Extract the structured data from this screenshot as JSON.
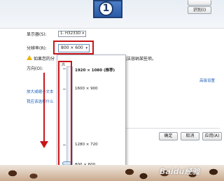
{
  "monitor": {
    "number": "1"
  },
  "buttons": {
    "detect_label": "",
    "identify_label": "识别(I)",
    "ok": "确定",
    "cancel": "取消",
    "apply": "应用(A)"
  },
  "form": {
    "display_label": "显示器(S):",
    "display_value": "1. H3233D",
    "resolution_label": "分辨率(R):",
    "resolution_value": "800 × 600",
    "warning_text": "如果您的分",
    "warning_text_2": "无法容纳某些项。",
    "orientation_label": "方向(O):"
  },
  "links": {
    "advanced": "高级设置",
    "enlarge": "放大或缩小文本",
    "which_settings": "我应该选择什么"
  },
  "resolution_options": [
    "1920 × 1080 (推荐)",
    "1600 × 900",
    "1280 × 720",
    "800 × 600"
  ],
  "slider": {
    "high_label": "高",
    "low_label": "低",
    "selected_index": 3
  },
  "watermark": "Baidu经验",
  "colors": {
    "highlight_red": "#c7151a",
    "link_blue": "#1d5fb8",
    "warning": "#f0b400"
  }
}
